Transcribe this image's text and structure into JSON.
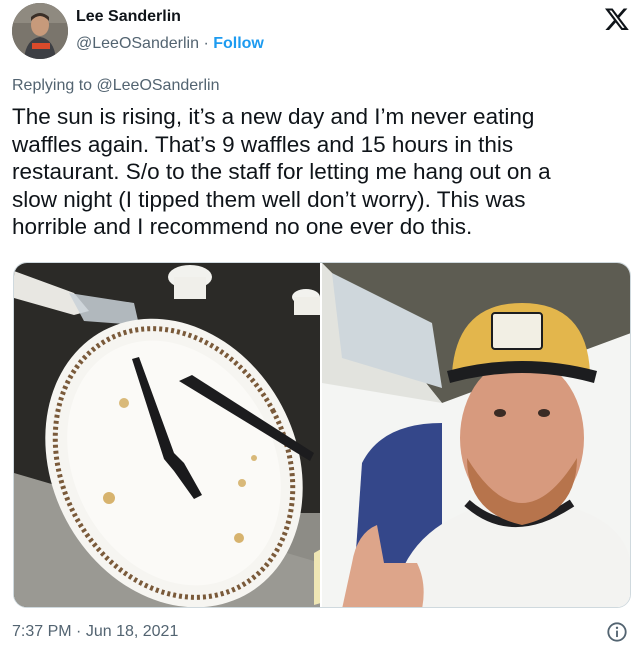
{
  "author": {
    "display_name": "Lee Sanderlin",
    "handle": "@LeeOSanderlin",
    "separator": "·",
    "follow_label": "Follow"
  },
  "reply": {
    "prefix": "Replying to",
    "mention": "@LeeOSanderlin"
  },
  "tweet": {
    "lines": [
      "The sun is rising, it’s a new day and I’m never eating",
      "waffles again. That’s 9 waffles and 15 hours in this",
      "restaurant. S/o to the staff for letting me hang out on a",
      "slow night (I tipped them well don’t worry). This was",
      "horrible and I recommend no one ever do this."
    ]
  },
  "media": {
    "images": [
      "empty-plate-photo",
      "thumbs-up-selfie-photo"
    ]
  },
  "meta": {
    "time": "7:37 PM",
    "separator": "·",
    "date": "Jun 18, 2021"
  },
  "icons": {
    "brand": "x-logo-icon",
    "info": "info-icon"
  },
  "colors": {
    "text": "#0f1419",
    "muted": "#536471",
    "accent": "#1d9bf0",
    "border": "#cfd9de"
  }
}
